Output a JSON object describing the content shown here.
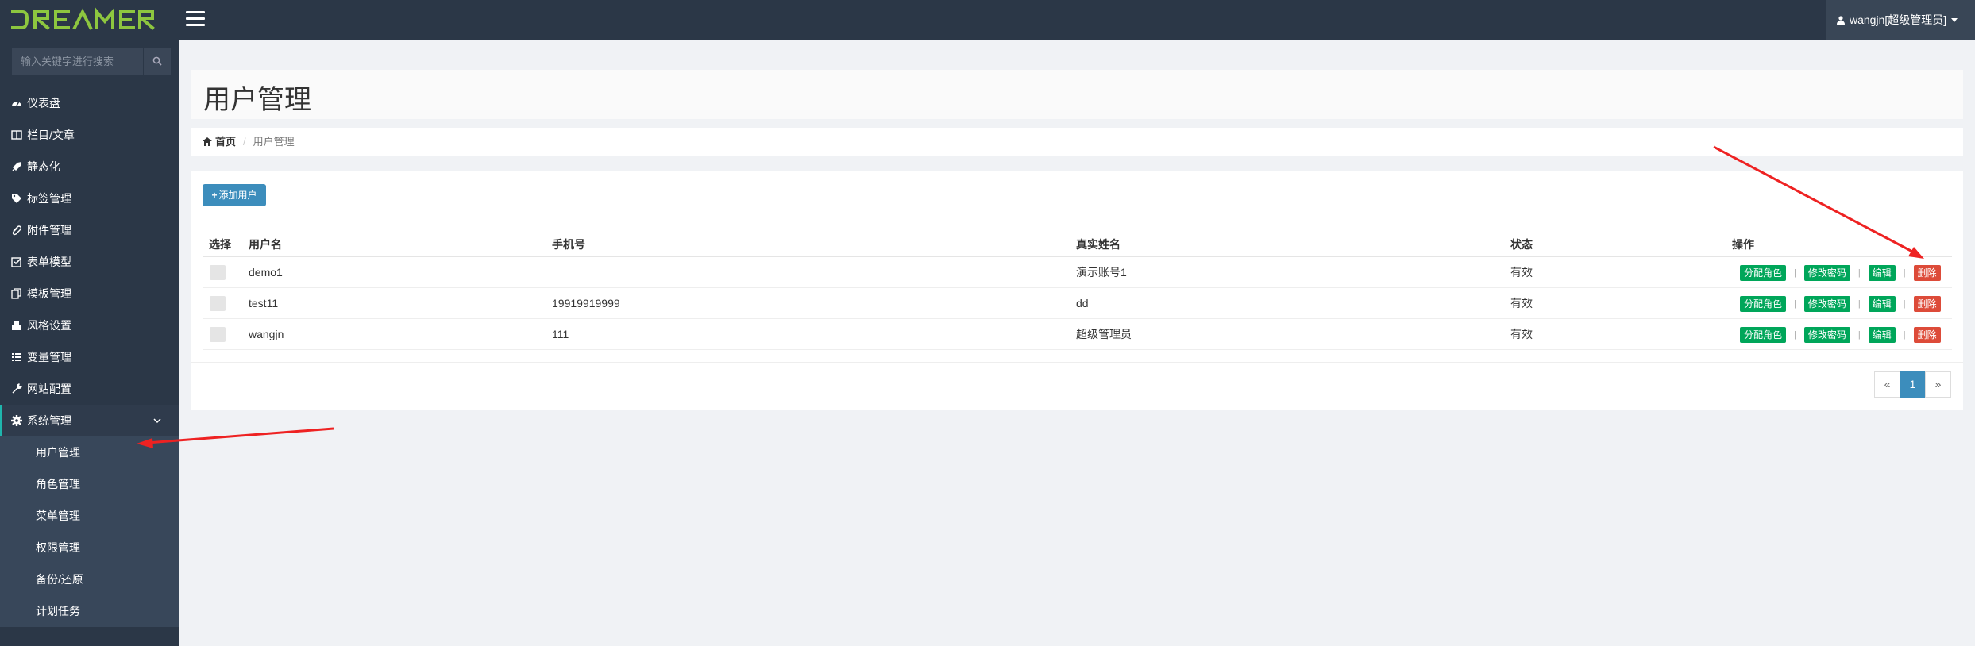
{
  "app": {
    "logo_text": "DREAMER",
    "logo_color": "#8dc63f",
    "user_label": "wangjn[超级管理员]"
  },
  "sidebar": {
    "search_placeholder": "输入关键字进行搜索",
    "items": [
      {
        "label": "仪表盘",
        "icon": "dashboard-icon"
      },
      {
        "label": "栏目/文章",
        "icon": "columns-icon"
      },
      {
        "label": "静态化",
        "icon": "rocket-icon"
      },
      {
        "label": "标签管理",
        "icon": "tags-icon"
      },
      {
        "label": "附件管理",
        "icon": "paperclip-icon"
      },
      {
        "label": "表单模型",
        "icon": "checkbox-icon"
      },
      {
        "label": "模板管理",
        "icon": "copy-icon"
      },
      {
        "label": "风格设置",
        "icon": "cubes-icon"
      },
      {
        "label": "变量管理",
        "icon": "list-icon"
      },
      {
        "label": "网站配置",
        "icon": "wrench-icon"
      },
      {
        "label": "系统管理",
        "icon": "gear-icon"
      }
    ],
    "submenu": [
      "用户管理",
      "角色管理",
      "菜单管理",
      "权限管理",
      "备份/还原",
      "计划任务"
    ]
  },
  "page": {
    "title": "用户管理",
    "breadcrumb_home": "首页",
    "breadcrumb_current": "用户管理",
    "add_button": "添加用户"
  },
  "table": {
    "headers": [
      "选择",
      "用户名",
      "手机号",
      "真实姓名",
      "状态",
      "操作"
    ],
    "rows": [
      {
        "username": "demo1",
        "phone": "",
        "realname": "演示账号1",
        "status": "有效"
      },
      {
        "username": "test11",
        "phone": "19919919999",
        "realname": "dd",
        "status": "有效"
      },
      {
        "username": "wangjn",
        "phone": "111",
        "realname": "超级管理员",
        "status": "有效"
      }
    ],
    "actions": [
      "分配角色",
      "修改密码",
      "编辑",
      "删除"
    ]
  },
  "pagination": {
    "prev": "«",
    "current": "1",
    "next": "»"
  },
  "colors": {
    "topbar": "#2b3747",
    "primary": "#3c8dbc",
    "success": "#00a65a",
    "danger": "#dd4b39",
    "annotation": "#ee2222"
  }
}
